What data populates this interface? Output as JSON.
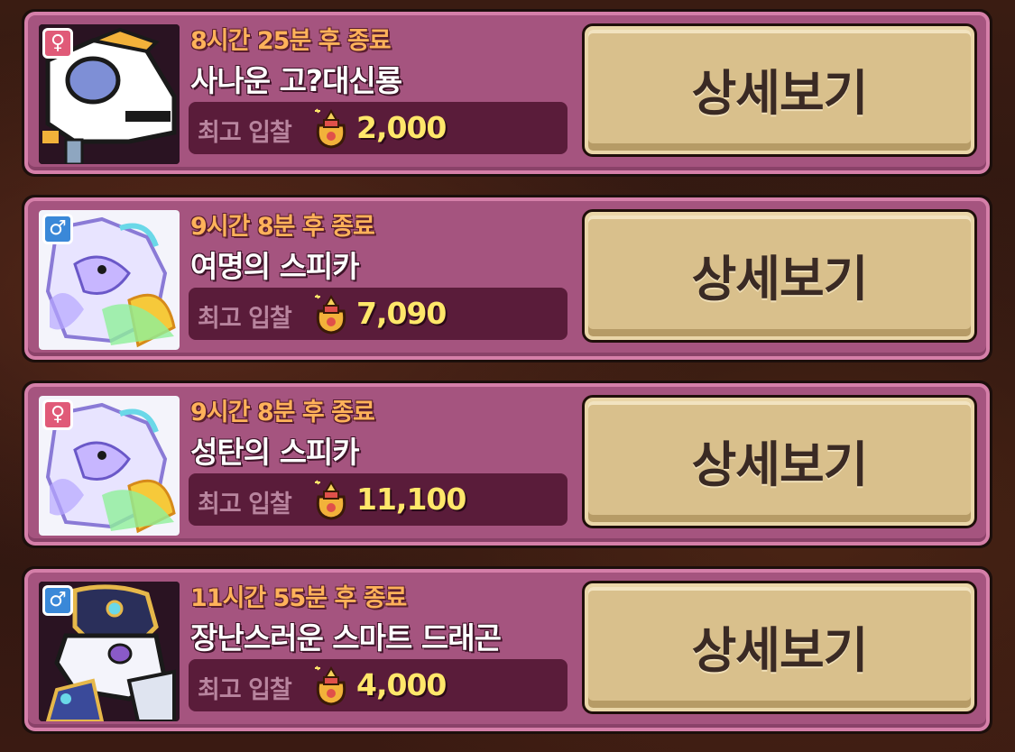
{
  "auction_list": {
    "items": [
      {
        "gender": "female",
        "gender_symbol": "♀",
        "time_left": "8시간 25분 후 종료",
        "name": "사나운 고?대신룡",
        "bid_label": "최고 입찰",
        "bid_value": "2,000",
        "button_label": "상세보기",
        "portrait_icon": "white-dragon-portrait"
      },
      {
        "gender": "male",
        "gender_symbol": "♂",
        "time_left": "9시간 8분 후 종료",
        "name": "여명의 스피카",
        "bid_label": "최고 입찰",
        "bid_value": "7,090",
        "button_label": "상세보기",
        "portrait_icon": "rainbow-spica-portrait"
      },
      {
        "gender": "female",
        "gender_symbol": "♀",
        "time_left": "9시간 8분 후 종료",
        "name": "성탄의 스피카",
        "bid_label": "최고 입찰",
        "bid_value": "11,100",
        "button_label": "상세보기",
        "portrait_icon": "rainbow-spica-portrait"
      },
      {
        "gender": "male",
        "gender_symbol": "♂",
        "time_left": "11시간 55분 후 종료",
        "name": "장난스러운 스마트 드래곤",
        "bid_label": "최고 입찰",
        "bid_value": "4,000",
        "button_label": "상세보기",
        "portrait_icon": "smart-dragon-portrait"
      }
    ],
    "currency_icon": "gold-pouch-icon",
    "colors": {
      "card_bg": "#a5547f",
      "timer": "#ffb25a",
      "bid_value": "#ffe76a",
      "button": "#d9c08c"
    }
  }
}
